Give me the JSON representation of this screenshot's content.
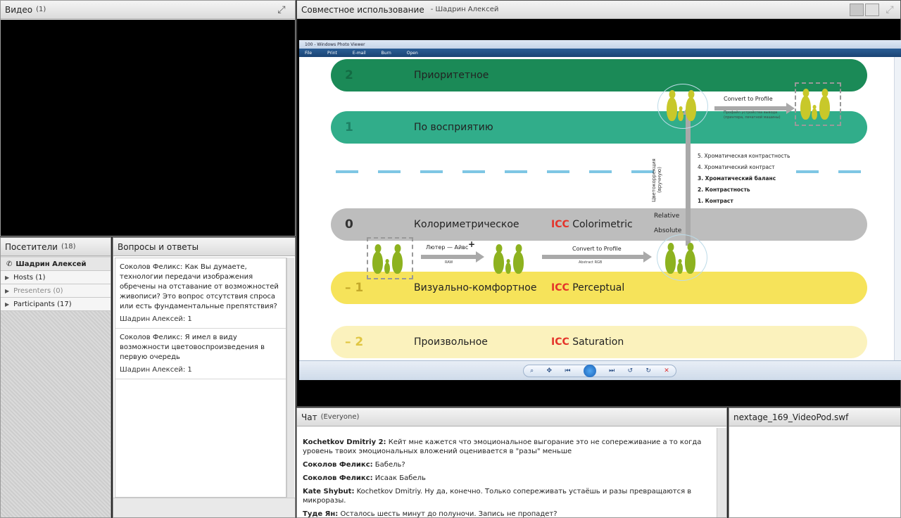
{
  "video": {
    "title": "Видео",
    "count": "(1)"
  },
  "share": {
    "title": "Совместное использование",
    "presenter": "- Шадрин Алексей"
  },
  "viewer": {
    "window_title": "100 - Windows Photo Viewer",
    "menu": [
      "File",
      "Print",
      "E-mail",
      "Burn",
      "Open"
    ]
  },
  "slide": {
    "bands": [
      {
        "num": "2",
        "label": "Приоритетное",
        "icc_prefix": "",
        "icc_text": ""
      },
      {
        "num": "1",
        "label": "По восприятию",
        "icc_prefix": "",
        "icc_text": ""
      },
      {
        "num": "0",
        "label": "Колориметрическое",
        "icc_prefix": "ICC",
        "icc_text": " Colorimetric"
      },
      {
        "num": "– 1",
        "label": "Визуально-комфортное",
        "icc_prefix": "ICC",
        "icc_text": " Perceptual"
      },
      {
        "num": "– 2",
        "label": "Произвольное",
        "icc_prefix": "ICC",
        "icc_text": " Saturation"
      }
    ],
    "convert_top": "Convert to Profile",
    "convert_top_sub": "Профайл устройства вывода (принтера, печатной машины)",
    "convert_mid": "Convert to Profile",
    "convert_mid_sub": "Abstract RGB",
    "luther": "Лютер — Айвс",
    "plus": "+",
    "raw": "RAW",
    "relative": "Relative",
    "absolute": "Absolute",
    "vertical_label": "Цветокоррекция (вручную)",
    "list": [
      "5. Хроматическая контрастность",
      "4. Хроматический контраст",
      "3. Хроматический баланс",
      "2. Контрастность",
      "1. Контраст"
    ]
  },
  "attendees": {
    "title": "Посетители",
    "count": "(18)",
    "me": "Шадрин Алексей",
    "groups": [
      "Hosts (1)",
      "Presenters (0)",
      "Participants (17)"
    ]
  },
  "qa": {
    "title": "Вопросы и ответы",
    "items": [
      {
        "q": "Соколов Феликс: Как Вы думаете, технологии передачи изображения обречены на отставание от возможностей живописи? Это вопрос отсутствия спроса или есть фундаментальные препятствия?",
        "a": "Шадрин Алексей: 1"
      },
      {
        "q": "Соколов Феликс: Я имел в виду возможности цветовоспроизведения в первую очередь",
        "a": "Шадрин Алексей: 1"
      }
    ]
  },
  "chat": {
    "title": "Чат",
    "scope": "(Everyone)",
    "messages": [
      {
        "author": "Kochetkov Dmitriy 2:",
        "text": " Кейт мне кажется что эмоциональное выгорание это не сопереживание а то когда уровень твоих эмоциональных вложений оценивается в \"разы\" меньше"
      },
      {
        "author": "Соколов Феликс:",
        "text": " Бабель?"
      },
      {
        "author": "Соколов Феликс:",
        "text": " Исаак Бабель"
      },
      {
        "author": "Kate Shybut:",
        "text": " Kochetkov Dmitriy. Ну да, конечно. Только сопереживать устаёшь и разы превращаются в микроразы."
      },
      {
        "author": "Туде Ян:",
        "text": " Осталось шесть минут до полуночи. Запись не пропадет?"
      }
    ]
  },
  "swf": {
    "title": "nextage_169_VideoPod.swf"
  }
}
